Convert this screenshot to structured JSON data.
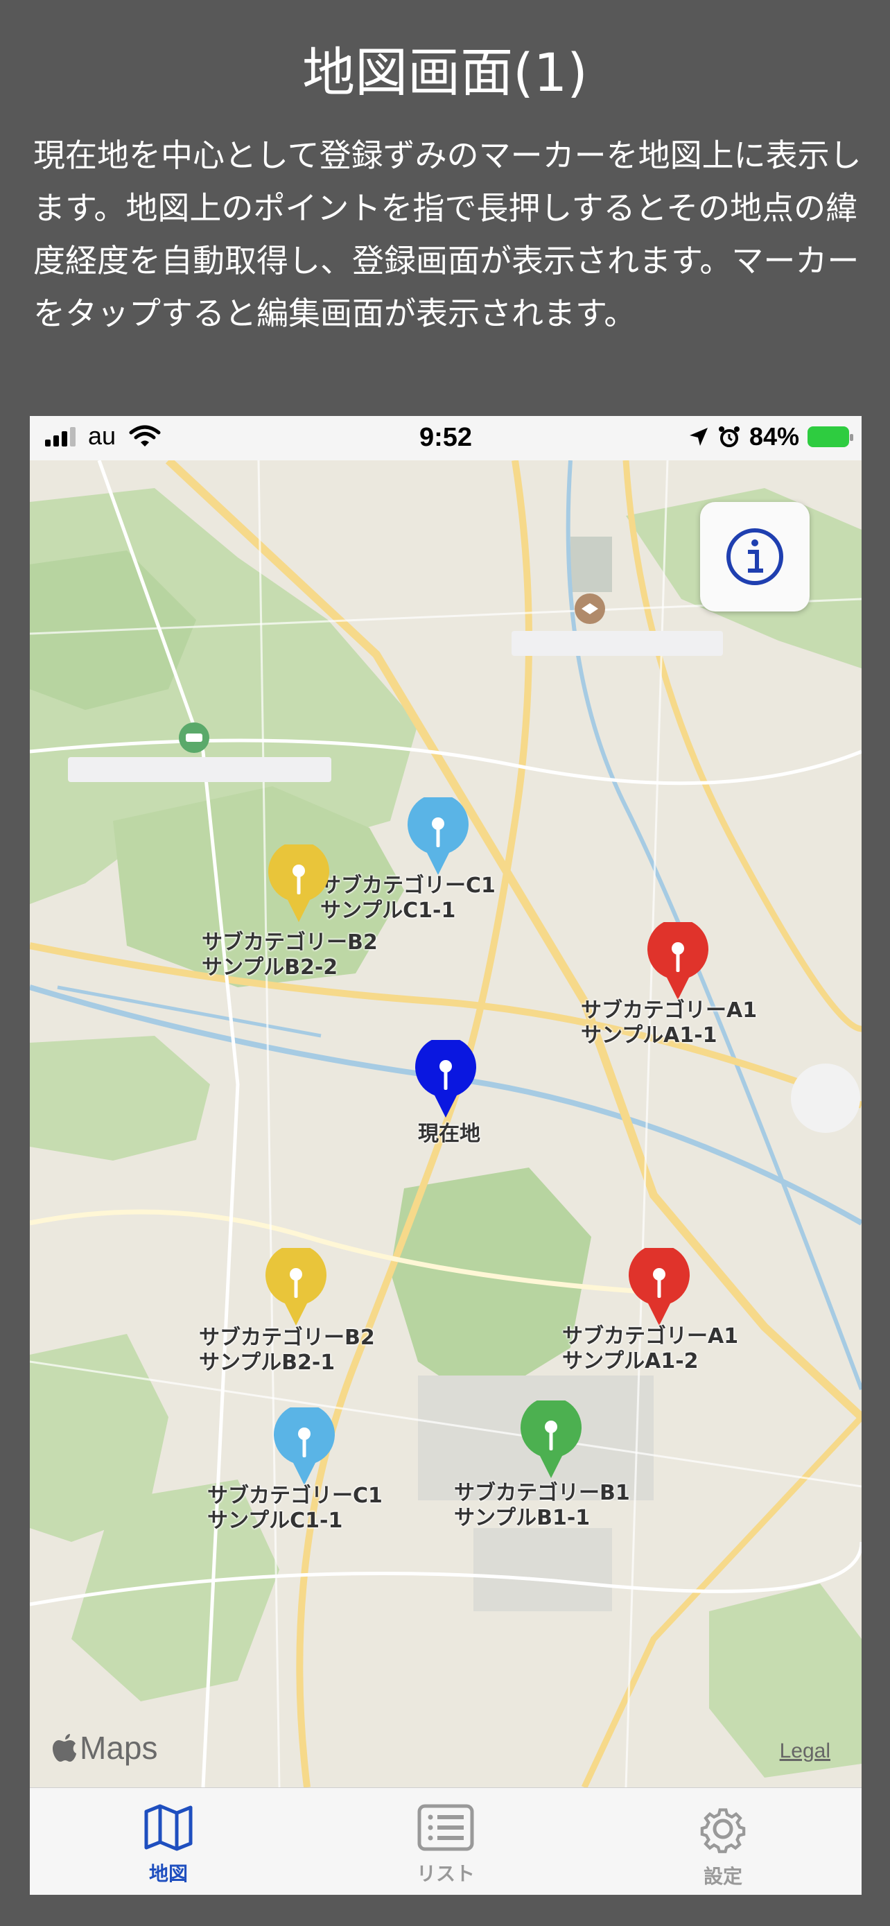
{
  "page": {
    "title": "地図画面(1)",
    "description": "現在地を中心として登録ずみのマーカーを地図上に表示します。地図上のポイントを指で長押しするとその地点の緯度経度を自動取得し、登録画面が表示されます。マーカーをタップすると編集画面が表示されます。"
  },
  "status_bar": {
    "carrier": "au",
    "time": "9:52",
    "battery": "84%"
  },
  "map": {
    "markers": [
      {
        "color": "#5ab4e6",
        "label_line1": "サブカテゴリーC1",
        "label_line2": "サンプルC1-1"
      },
      {
        "color": "#e9c53a",
        "label_line1": "サブカテゴリーB2",
        "label_line2": "サンプルB2-2"
      },
      {
        "color": "#e0332b",
        "label_line1": "サブカテゴリーA1",
        "label_line2": "サンプルA1-1"
      },
      {
        "color": "#0a17e0",
        "label_line1": "現在地",
        "label_line2": ""
      },
      {
        "color": "#e9c53a",
        "label_line1": "サブカテゴリーB2",
        "label_line2": "サンプルB2-1"
      },
      {
        "color": "#e0332b",
        "label_line1": "サブカテゴリーA1",
        "label_line2": "サンプルA1-2"
      },
      {
        "color": "#5ab4e6",
        "label_line1": "サブカテゴリーC1",
        "label_line2": "サンプルC1-1"
      },
      {
        "color": "#4cb050",
        "label_line1": "サブカテゴリーB1",
        "label_line2": "サンプルB1-1"
      }
    ],
    "maps_logo": "Maps",
    "legal": "Legal"
  },
  "tabbar": {
    "accent": "#1f4fbf",
    "tabs": [
      {
        "label": "地図",
        "icon": "map-icon",
        "selected": true
      },
      {
        "label": "リスト",
        "icon": "list-icon",
        "selected": false
      },
      {
        "label": "設定",
        "icon": "gear-icon",
        "selected": false
      }
    ]
  }
}
